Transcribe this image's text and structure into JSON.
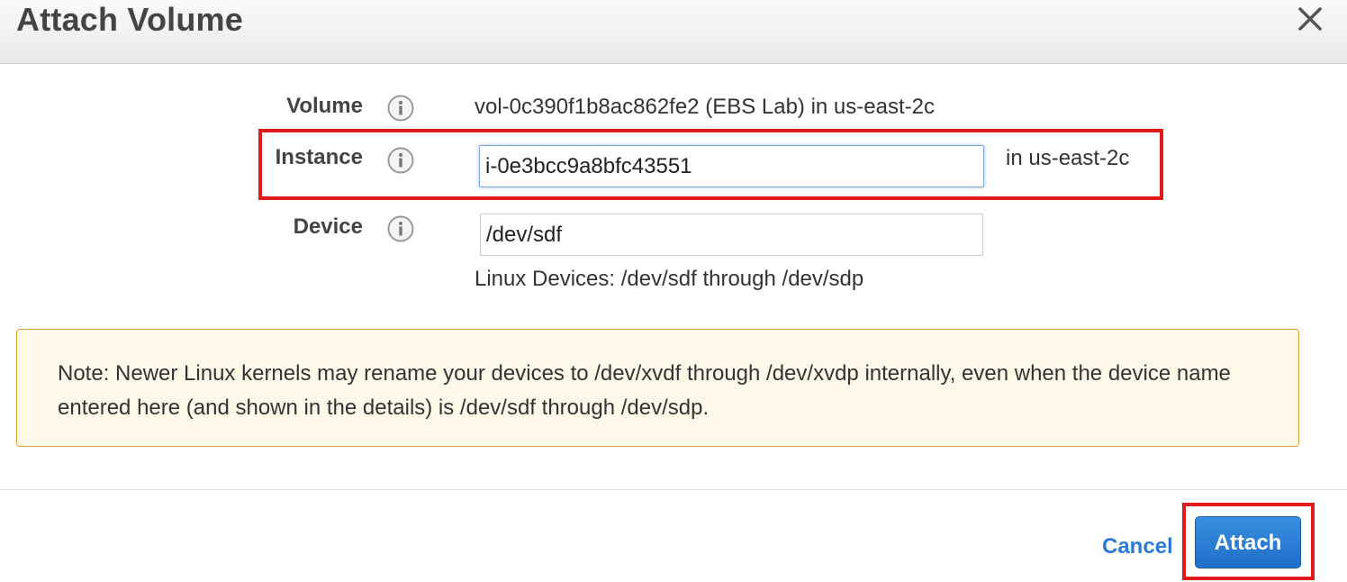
{
  "dialog": {
    "title": "Attach Volume",
    "close_icon": "close-icon"
  },
  "volume": {
    "label": "Volume",
    "info_icon": "info-icon",
    "value": "vol-0c390f1b8ac862fe2 (EBS Lab) in us-east-2c"
  },
  "instance": {
    "label": "Instance",
    "info_icon": "info-icon",
    "value": "i-0e3bcc9a8bfc43551",
    "suffix": "in us-east-2c"
  },
  "device": {
    "label": "Device",
    "info_icon": "info-icon",
    "value": "/dev/sdf",
    "hint": "Linux Devices: /dev/sdf through /dev/sdp"
  },
  "note": {
    "text": "Note: Newer Linux kernels may rename your devices to /dev/xvdf through /dev/xvdp internally, even when the device name entered here (and shown in the details) is /dev/sdf through /dev/sdp."
  },
  "footer": {
    "cancel_label": "Cancel",
    "attach_label": "Attach"
  },
  "colors": {
    "highlight": "#e0191b",
    "primary": "#1e6fc8",
    "link": "#2b7bd6",
    "note_bg": "#fdf8e8",
    "note_border": "#e3a23a"
  }
}
